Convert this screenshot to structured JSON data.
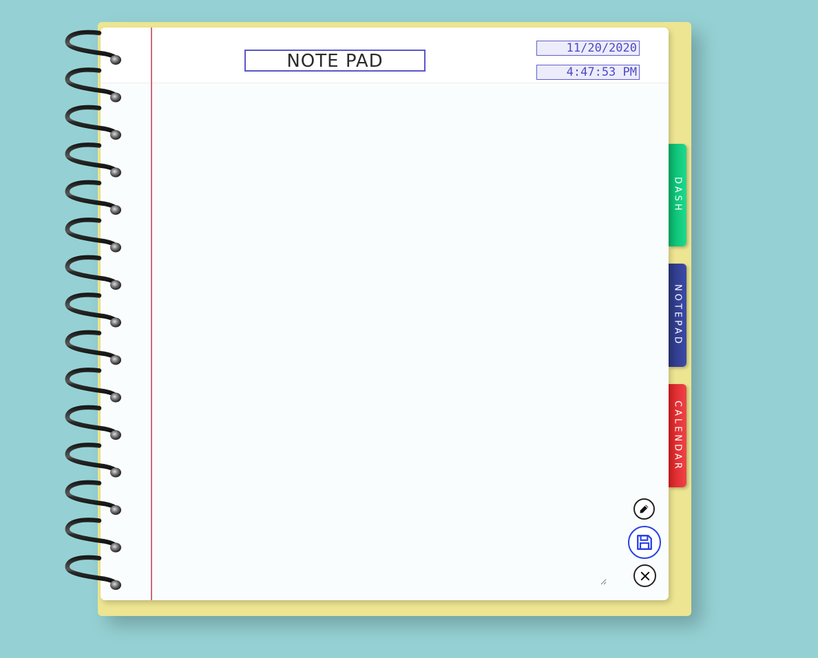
{
  "app": {
    "title": "NOTE PAD"
  },
  "header": {
    "date": "11/20/2020",
    "time": "4:47:53 PM"
  },
  "note": {
    "value": "",
    "placeholder": ""
  },
  "tabs": [
    {
      "label": "DASH",
      "color": "#06b26b"
    },
    {
      "label": "NOTEPAD",
      "color": "#2a367e"
    },
    {
      "label": "CALENDAR",
      "color": "#d52124"
    }
  ],
  "actions": {
    "edit_icon": "pen-icon",
    "save_icon": "floppy-disk-icon",
    "close_icon": "close-circle-icon"
  },
  "colors": {
    "background": "#95d1d4",
    "back_cover": "#ede591",
    "ruled_line": "#98d0cf",
    "margin_line": "#c96a78",
    "stamp": "#4e49c8",
    "save_accent": "#2a43e6"
  }
}
